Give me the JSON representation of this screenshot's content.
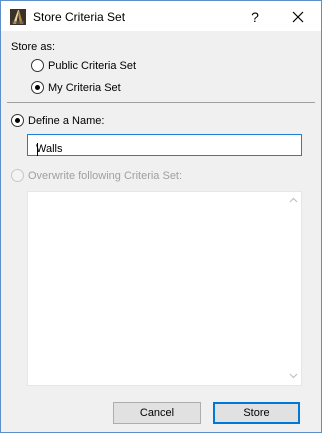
{
  "window": {
    "title": "Store Criteria Set",
    "help_label": "?",
    "icons": {
      "app": "archicad-icon",
      "close": "close-icon"
    }
  },
  "store_as": {
    "heading": "Store as:",
    "options": [
      {
        "label": "Public Criteria Set",
        "selected": false
      },
      {
        "label": "My Criteria Set",
        "selected": true
      }
    ]
  },
  "define_name": {
    "label": "Define a Name:",
    "selected": true,
    "value": "Walls"
  },
  "overwrite": {
    "label": "Overwrite following Criteria Set:",
    "selected": false,
    "enabled": false,
    "items": []
  },
  "buttons": {
    "cancel": "Cancel",
    "store": "Store"
  },
  "colors": {
    "accent": "#0078d7",
    "window_border": "#5d8fc8",
    "disabled_text": "#a0a0a0"
  }
}
